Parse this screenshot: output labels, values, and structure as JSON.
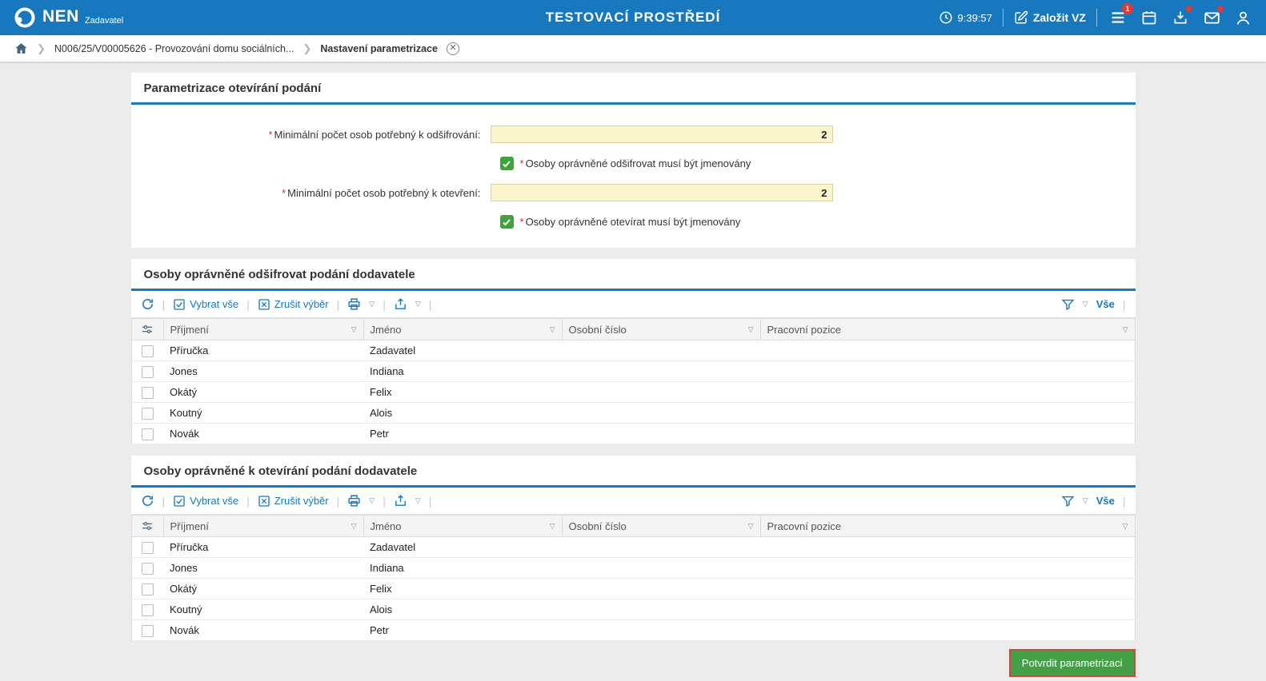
{
  "header": {
    "brand": "NEN",
    "brand_sub": "Zadavatel",
    "env_title": "TESTOVACÍ PROSTŘEDÍ",
    "time": "9:39:57",
    "create_vz_label": "Založit VZ",
    "menu_badge": "1"
  },
  "breadcrumb": {
    "contract": "N006/25/V00005626 - Provozování domu sociálních...",
    "current": "Nastavení parametrizace"
  },
  "parametrization": {
    "title": "Parametrizace otevírání podání",
    "required_mark": "*",
    "min_decrypt_label": "Minimální počet osob potřebný k odšifrování:",
    "min_decrypt_value": "2",
    "decrypt_check_label": "Osoby oprávněné odšifrovat musí být jmenovány",
    "min_open_label": "Minimální počet osob potřebný k otevření:",
    "min_open_value": "2",
    "open_check_label": "Osoby oprávněné otevírat musí být jmenovány"
  },
  "toolbar": {
    "select_all": "Vybrat vše",
    "clear_selection": "Zrušit výběr",
    "view_all": "Vše"
  },
  "decrypt_table": {
    "title": "Osoby oprávněné odšifrovat podání dodavatele",
    "columns": [
      "Příjmení",
      "Jméno",
      "Osobní číslo",
      "Pracovní pozice"
    ],
    "rows": [
      [
        "Příručka",
        "Zadavatel",
        "",
        ""
      ],
      [
        "Jones",
        "Indiana",
        "",
        ""
      ],
      [
        "Okátý",
        "Felix",
        "",
        ""
      ],
      [
        "Koutný",
        "Alois",
        "",
        ""
      ],
      [
        "Novák",
        "Petr",
        "",
        ""
      ]
    ]
  },
  "open_table": {
    "title": "Osoby oprávněné k otevírání podání dodavatele",
    "columns": [
      "Příjmení",
      "Jméno",
      "Osobní číslo",
      "Pracovní pozice"
    ],
    "rows": [
      [
        "Příručka",
        "Zadavatel",
        "",
        ""
      ],
      [
        "Jones",
        "Indiana",
        "",
        ""
      ],
      [
        "Okátý",
        "Felix",
        "",
        ""
      ],
      [
        "Koutný",
        "Alois",
        "",
        ""
      ],
      [
        "Novák",
        "Petr",
        "",
        ""
      ]
    ]
  },
  "footer": {
    "confirm_label": "Potvrdit parametrizaci"
  },
  "colors": {
    "header_blue": "#1778be",
    "accent_blue": "#1778be",
    "input_yellow": "#fbf5cd",
    "check_green": "#3fa33c",
    "button_green": "#43a047",
    "badge_red": "#e53935"
  }
}
